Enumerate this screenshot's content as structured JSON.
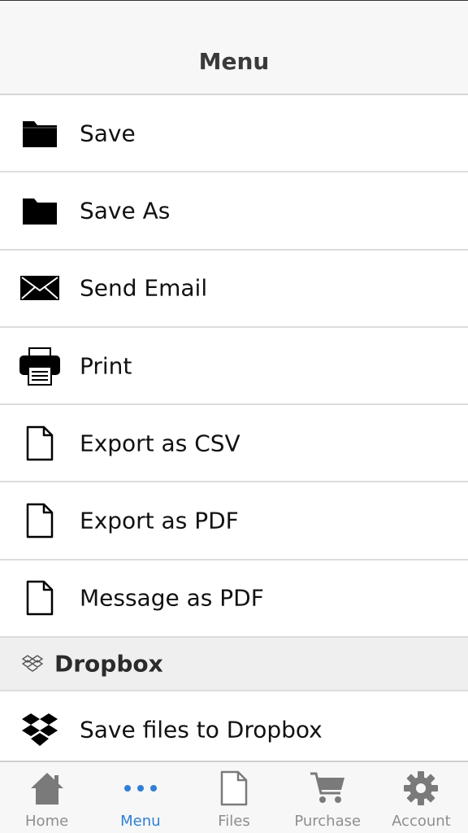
{
  "nav": {
    "title": "Menu"
  },
  "menu": {
    "items": [
      {
        "label": "Save",
        "icon": "folder-icon"
      },
      {
        "label": "Save As",
        "icon": "folder-icon"
      },
      {
        "label": "Send Email",
        "icon": "envelope-icon"
      },
      {
        "label": "Print",
        "icon": "printer-icon"
      },
      {
        "label": "Export as CSV",
        "icon": "document-icon"
      },
      {
        "label": "Export as PDF",
        "icon": "document-icon"
      },
      {
        "label": "Message as PDF",
        "icon": "document-icon"
      }
    ],
    "section": {
      "label": "Dropbox",
      "icon": "dropbox-icon"
    },
    "dropbox_items": [
      {
        "label": "Save files to Dropbox",
        "icon": "dropbox-icon"
      }
    ]
  },
  "tabs": [
    {
      "label": "Home",
      "icon": "home-icon",
      "active": false
    },
    {
      "label": "Menu",
      "icon": "more-dots-icon",
      "active": true
    },
    {
      "label": "Files",
      "icon": "files-icon",
      "active": false
    },
    {
      "label": "Purchase",
      "icon": "cart-icon",
      "active": false
    },
    {
      "label": "Account",
      "icon": "gear-icon",
      "active": false
    }
  ],
  "colors": {
    "active_tab": "#2f7fd6",
    "inactive_tab": "#8e8e8e",
    "icon_gray": "#7a7a7a"
  }
}
